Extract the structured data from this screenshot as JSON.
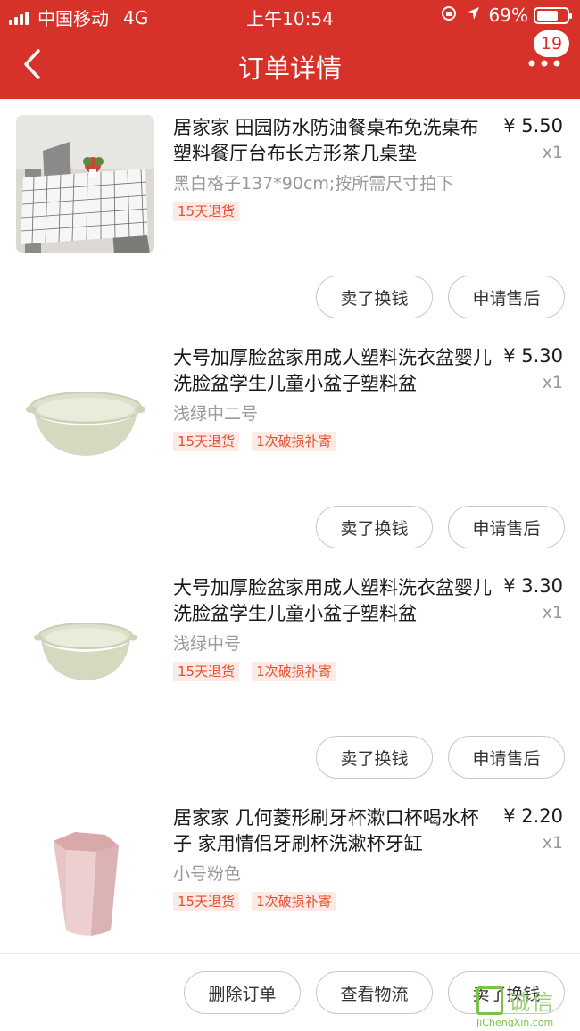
{
  "status_bar": {
    "carrier": "中国移动",
    "network": "4G",
    "time": "上午10:54",
    "battery": "69%"
  },
  "nav": {
    "title": "订单详情",
    "badge_count": "19"
  },
  "items": [
    {
      "title": "居家家 田园防水防油餐桌布免洗桌布 塑料餐厅台布长方形茶几桌垫",
      "spec": "黑白格子137*90cm;按所需尺寸拍下",
      "tags": [
        "15天退货"
      ],
      "price": "¥ 5.50",
      "qty": "x1",
      "buttons": [
        "卖了换钱",
        "申请售后"
      ]
    },
    {
      "title": "大号加厚脸盆家用成人塑料洗衣盆婴儿洗脸盆学生儿童小盆子塑料盆",
      "spec": "浅绿中二号",
      "tags": [
        "15天退货",
        "1次破损补寄"
      ],
      "price": "¥ 5.30",
      "qty": "x1",
      "buttons": [
        "卖了换钱",
        "申请售后"
      ]
    },
    {
      "title": "大号加厚脸盆家用成人塑料洗衣盆婴儿洗脸盆学生儿童小盆子塑料盆",
      "spec": "浅绿中号",
      "tags": [
        "15天退货",
        "1次破损补寄"
      ],
      "price": "¥ 3.30",
      "qty": "x1",
      "buttons": [
        "卖了换钱",
        "申请售后"
      ]
    },
    {
      "title": "居家家 几何菱形刷牙杯漱口杯喝水杯子 家用情侣牙刷杯洗漱杯牙缸",
      "spec": "小号粉色",
      "tags": [
        "15天退货",
        "1次破损补寄"
      ],
      "price": "¥ 2.20",
      "qty": "x1",
      "buttons": []
    }
  ],
  "bottom_bar": {
    "buttons": [
      "删除订单",
      "查看物流",
      "卖了换钱"
    ]
  },
  "watermark": {
    "text": "诚信",
    "url": "JiChengXin.com"
  },
  "colors": {
    "brand_red": "#d6322a",
    "tag_bg": "#fde9e6",
    "tag_text": "#e4512f"
  }
}
